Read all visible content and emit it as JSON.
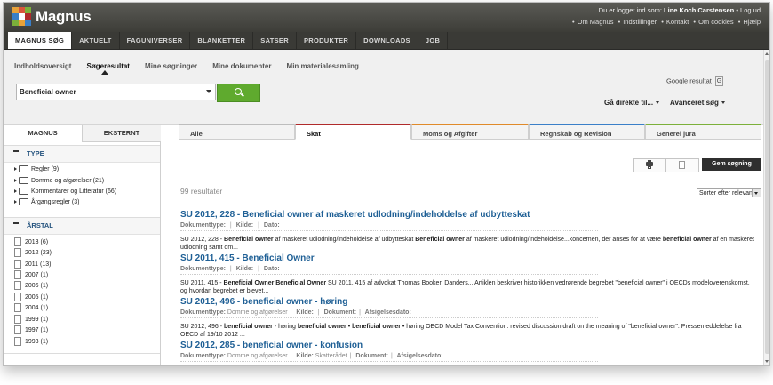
{
  "colors": {
    "accent_green": "#5faa2e",
    "link_blue": "#1e5f95",
    "header_dark": "#3a3a36",
    "tab_skat": "#b02a2a",
    "tab_moms": "#e08a2a",
    "tab_regnskab": "#3a7fc8",
    "tab_generel": "#7cb03a"
  },
  "header": {
    "logo_text": "Magnus",
    "login_text": "Du er logget ind som:",
    "user_name": "Line Koch Carstensen",
    "logout": "Log ud",
    "links": [
      "Om Magnus",
      "Indstillinger",
      "Kontakt",
      "Om cookies",
      "Hjælp"
    ]
  },
  "mainnav": [
    "MAGNUS SØG",
    "AKTUELT",
    "FAGUNIVERSER",
    "BLANKETTER",
    "SATSER",
    "PRODUKTER",
    "DOWNLOADS",
    "JOB"
  ],
  "subnav": [
    "Indholdsoversigt",
    "Søgeresultat",
    "Mine søgninger",
    "Mine dokumenter",
    "Min materialesamling"
  ],
  "search": {
    "value": "Beneficial owner",
    "google_label": "Google resultat",
    "google_checkbox": "G"
  },
  "goto_label": "Gå direkte til...",
  "advanced_label": "Avanceret søg",
  "sidebar": {
    "tabs": [
      "MAGNUS",
      "EKSTERNT"
    ],
    "type_label": "TYPE",
    "type_items": [
      "Regler (9)",
      "Domme og afgørelser (21)",
      "Kommentarer og Litteratur (66)",
      "Årgangsregler (3)"
    ],
    "year_label": "ÅRSTAL",
    "year_items": [
      "2013 (6)",
      "2012 (23)",
      "2011 (13)",
      "2007 (1)",
      "2006 (1)",
      "2005 (1)",
      "2004 (1)",
      "1999 (1)",
      "1997 (1)",
      "1993 (1)"
    ]
  },
  "content_tabs": [
    "Alle",
    "Skat",
    "Moms og Afgifter",
    "Regnskab og Revision",
    "Generel jura"
  ],
  "toolbar": {
    "save_label": "Gem søgning",
    "print_icon": "printer-icon",
    "pdf_icon": "pdf-icon"
  },
  "results_count": "99 resultater",
  "sort_label": "Sorter efter relevans",
  "meta_labels": {
    "doctype": "Dokumenttype:",
    "source": "Kilde:",
    "date": "Dato:",
    "document": "Dokument:",
    "decision_date": "Afsigelsesdato:"
  },
  "results": [
    {
      "title": "SU 2012, 228 - Beneficial owner af maskeret udlodning/indeholdelse af udbytteskat",
      "doctype": "",
      "source": "",
      "snippet": [
        [
          "SU 2012, 228 - ",
          false
        ],
        [
          "Beneficial owner",
          true
        ],
        [
          " af maskeret udlodning/indeholdelse af udbytteskat ",
          false
        ],
        [
          "Beneficial owner",
          true
        ],
        [
          " af maskeret udlodning/indeholdelse...koncernen, der anses for at være ",
          false
        ],
        [
          "beneficial owner",
          true
        ],
        [
          " af en maskeret udlodning samt om...",
          false
        ]
      ]
    },
    {
      "title": "SU 2011, 415 - Beneficial Owner",
      "doctype": "",
      "source": "",
      "snippet": [
        [
          "SU 2011, 415 - ",
          false
        ],
        [
          "Beneficial Owner Beneficial Owner",
          true
        ],
        [
          " SU 2011, 415 af advokat Thomas Booker, Danders... Artiklen beskriver historikken vedrørende begrebet \"beneficial owner\" i OECDs modeloverenskomst, og hvordan begrebet er blevet...",
          false
        ]
      ]
    },
    {
      "title": "SU 2012, 496 - beneficial owner - høring",
      "doctype": "Domme og afgørelser",
      "source": "",
      "snippet": [
        [
          "SU 2012, 496 - ",
          false
        ],
        [
          "beneficial owner",
          true
        ],
        [
          " - høring ",
          false
        ],
        [
          "beneficial owner • beneficial owner •",
          true
        ],
        [
          " høring OECD Model Tax Convention: revised discussion draft on the meaning of \"beneficial owner\". Pressemeddelelse fra OECD af 19/10 2012 ...",
          false
        ]
      ]
    },
    {
      "title": "SU 2012, 285 - beneficial owner - konfusion",
      "doctype": "Domme og afgørelser",
      "source": "Skatterådet",
      "snippet": []
    }
  ]
}
